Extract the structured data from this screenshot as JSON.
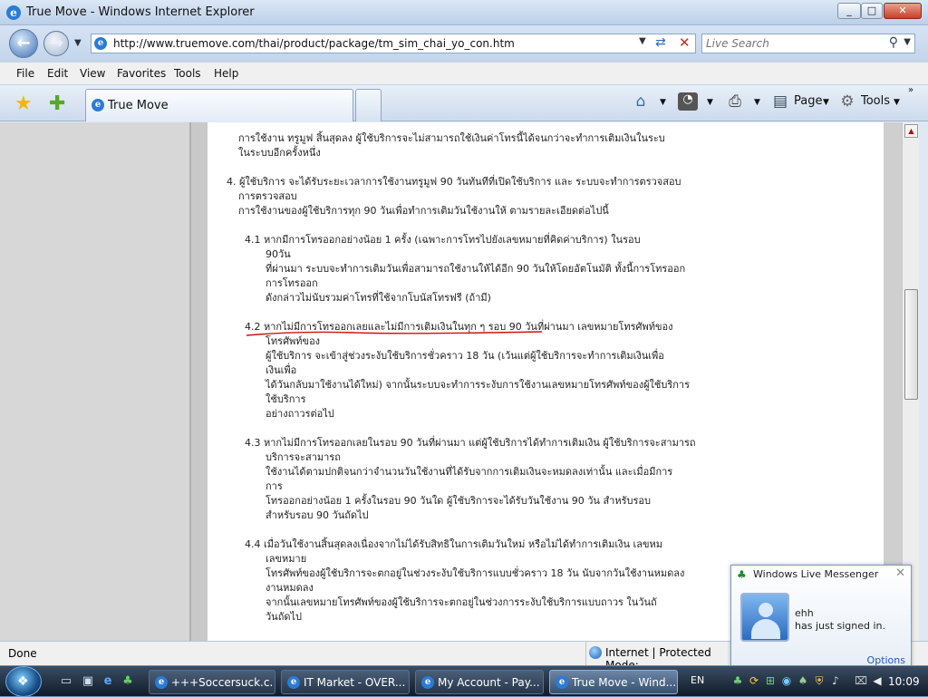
{
  "window": {
    "title": "True Move - Windows Internet Explorer",
    "minimize": "_",
    "maximize": "□",
    "close": "✕"
  },
  "address": {
    "url": "http://www.truemove.com/thai/product/package/tm_sim_chai_yo_con.htm",
    "search_placeholder": "Live Search"
  },
  "menu": [
    "File",
    "Edit",
    "View",
    "Favorites",
    "Tools",
    "Help"
  ],
  "tabs": {
    "active_label": "True Move"
  },
  "commands": {
    "page": "Page",
    "tools": "Tools"
  },
  "content": {
    "lines": [
      "การใช้งาน ทรูมูฟ สิ้นสุดลง ผู้ใช้บริการจะไม่สามารถใช้เงินค่าโทรนี้ได้จนกว่าจะทำการเติมเงินในระบ",
      "ในระบบอีกครั้งหนึ่ง",
      "4. ผู้ใช้บริการ จะได้รับระยะเวลาการใช้งานทรูมูฟ 90 วันทันทีที่เปิดใช้บริการ และ ระบบจะทำการตรวจสอบ",
      "การตรวจสอบ",
      "การใช้งานของผู้ใช้บริการทุก 90 วันเพื่อทำการเติมวันใช้งานให้ ตามรายละเอียดต่อไปนี้",
      "4.1  หากมีการโทรออกอย่างน้อย 1 ครั้ง (เฉพาะการโทรไปยังเลขหมายที่คิดค่าบริการ) ในรอบ",
      "90วัน",
      "ที่ผ่านมา ระบบจะทำการเติมวันเพื่อสามารถใช้งานให้ได้อีก 90 วันให้โดยอัตโนมัติ ทั้งนี้การโทรออก",
      "การโทรออก",
      "ดังกล่าวไม่นับรวมค่าโทรที่ใช้จากโบนัสโทรฟรี (ถ้ามี)",
      "4.2  หากไม่มีการโทรออกเลยและไม่มีการเติมเงินในทุก ๆ รอบ 90 วันที่ผ่านมา เลขหมายโทรศัพท์ของ",
      "โทรศัพท์ของ",
      "ผู้ใช้บริการ จะเข้าสู่ช่วงระงับใช้บริการชั่วคราว 18 วัน (เว้นแต่ผู้ใช้บริการจะทำการเติมเงินเพื่อ",
      "เงินเพื่อ",
      "ได้วันกลับมาใช้งานได้ใหม่) จากนั้นระบบจะทำการระงับการใช้งานเลขหมายโทรศัพท์ของผู้ใช้บริการ",
      "ใช้บริการ",
      "อย่างถาวรต่อไป",
      "4.3  หากไม่มีการโทรออกเลยในรอบ 90 วันที่ผ่านมา แต่ผู้ใช้บริการได้ทำการเติมเงิน ผู้ใช้บริการจะสามารถ",
      "บริการจะสามารถ",
      "ใช้งานได้ตามปกติจนกว่าจำนวนวันใช้งานที่ได้รับจากการเติมเงินจะหมดลงเท่านั้น และเมื่อมีการ",
      "การ",
      "โทรออกอย่างน้อย 1 ครั้งในรอบ 90 วันใด ผู้ใช้บริการจะได้รับวันใช้งาน 90 วัน สำหรับรอบ",
      "สำหรับรอบ 90 วันถัดไป",
      "4.4  เมื่อวันใช้งานสิ้นสุดลงเนื่องจากไม่ได้รับสิทธิในการเติมวันใหม่ หรือไม่ได้ทำการเติมเงิน เลขหม",
      "เลขหมาย",
      "โทรศัพท์ของผู้ใช้บริการจะตกอยู่ในช่วงระงับใช้บริการแบบชั่วคราว 18 วัน นับจากวันใช้งานหมดลง",
      "งานหมดลง",
      "จากนั้นเลขหมายโทรศัพท์ของผู้ใช้บริการจะตกอยู่ในช่วงการระงับใช้บริการแบบถาวร ในวันถั",
      "วันถัดไป"
    ]
  },
  "status": {
    "text": "Done",
    "zone": "Internet | Protected Mode:"
  },
  "toast": {
    "app": "Windows Live Messenger",
    "name": "ehh",
    "message": "has just signed in.",
    "options": "Options",
    "close": "✕"
  },
  "taskbar": {
    "tasks": [
      "+++Soccersuck.c...",
      "IT Market - OVER...",
      "My Account - Pay...",
      "True Move - Wind..."
    ],
    "lang": "EN",
    "clock": "10:09"
  },
  "colors": {
    "accent": "#2b7bd6",
    "annotation": "#cc1111"
  }
}
